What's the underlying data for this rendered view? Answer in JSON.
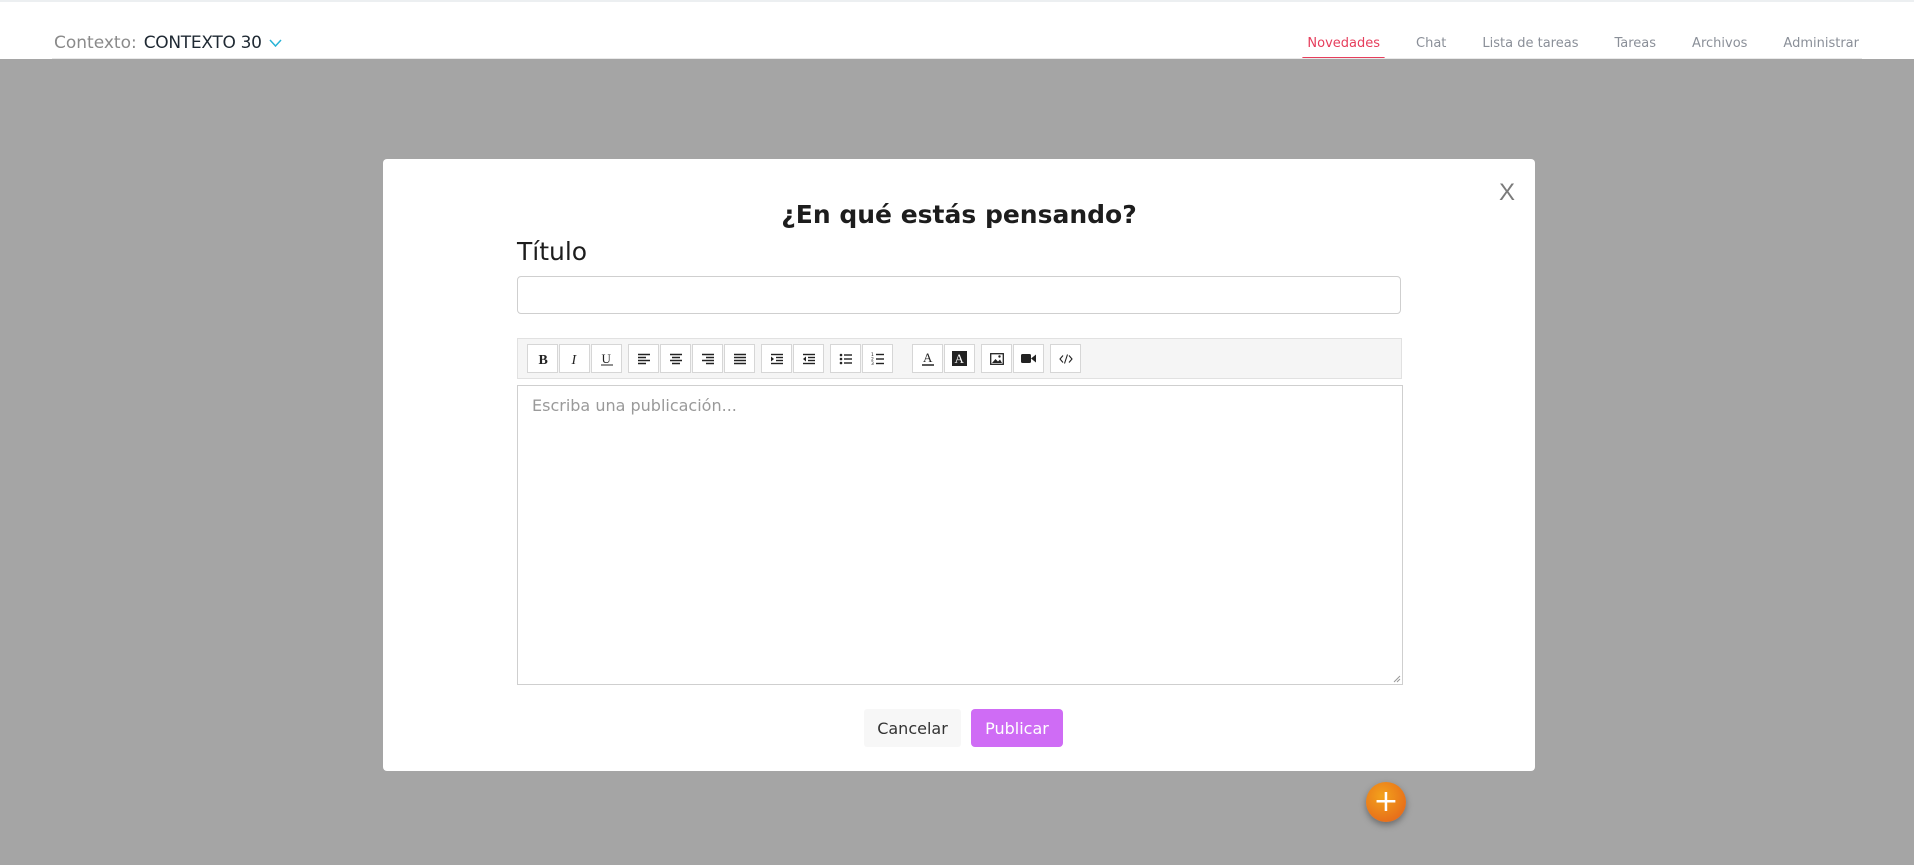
{
  "header": {
    "context_label": "Contexto:",
    "context_value": "CONTEXTO 30",
    "accent_color": "#e63e5c",
    "tabs": [
      {
        "label": "Novedades",
        "active": true
      },
      {
        "label": "Chat",
        "active": false
      },
      {
        "label": "Lista de tareas",
        "active": false
      },
      {
        "label": "Tareas",
        "active": false
      },
      {
        "label": "Archivos",
        "active": false
      },
      {
        "label": "Administrar",
        "active": false
      }
    ]
  },
  "modal": {
    "close_label": "X",
    "title": "¿En qué estás pensando?",
    "title_field_label": "Título",
    "title_input_value": "",
    "editor_placeholder": "Escriba una publicación...",
    "toolbar": [
      "bold-icon",
      "italic-icon",
      "underline-icon",
      "align-left-icon",
      "align-center-icon",
      "align-right-icon",
      "align-justify-icon",
      "indent-icon",
      "outdent-icon",
      "bullet-list-icon",
      "numbered-list-icon",
      "text-color-icon",
      "background-color-icon",
      "image-icon",
      "video-icon",
      "code-view-icon"
    ],
    "cancel_label": "Cancelar",
    "publish_label": "Publicar",
    "publish_color": "#cf6cf5"
  },
  "fab": {
    "icon": "plus-icon",
    "label": "+"
  }
}
